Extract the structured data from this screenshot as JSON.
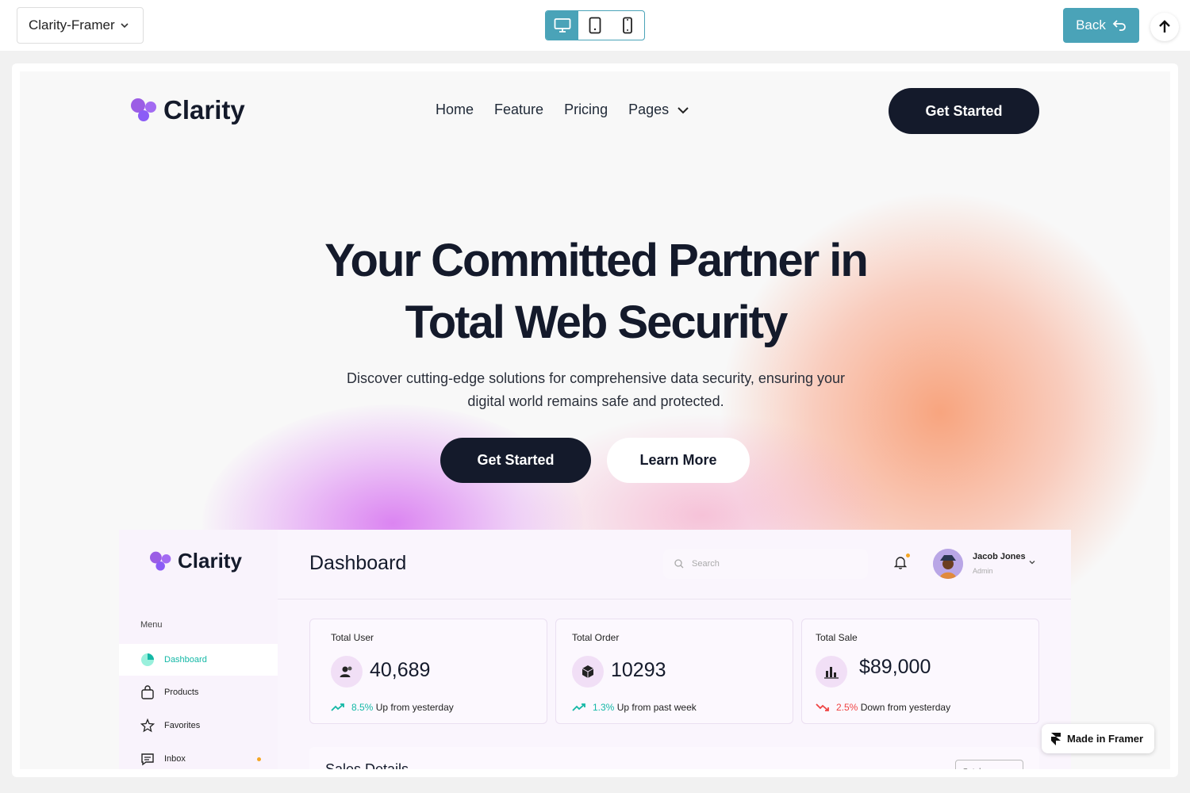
{
  "toolbar": {
    "template_name": "Clarity-Framer",
    "devices": [
      "desktop",
      "tablet",
      "mobile"
    ],
    "active_device": "desktop",
    "back_label": "Back",
    "accent_color": "#4aa3b8"
  },
  "site": {
    "logo_text": "Clarity",
    "nav": {
      "links": [
        "Home",
        "Feature",
        "Pricing",
        "Pages"
      ],
      "cta": "Get Started"
    },
    "hero": {
      "title_line1": "Your Committed Partner in",
      "title_line2": "Total Web Security",
      "subtitle_line1": "Discover cutting-edge solutions for comprehensive data security, ensuring your",
      "subtitle_line2": "digital world remains safe and protected.",
      "primary_cta": "Get Started",
      "secondary_cta": "Learn More"
    },
    "dashboard": {
      "logo_text": "Clarity",
      "title": "Dashboard",
      "search_placeholder": "Search",
      "user": {
        "name": "Jacob Jones",
        "role": "Admin"
      },
      "menu_label": "Menu",
      "menu_items": [
        {
          "label": "Dashboard",
          "icon": "pie-chart-icon",
          "active": true
        },
        {
          "label": "Products",
          "icon": "bag-icon"
        },
        {
          "label": "Favorites",
          "icon": "star-icon"
        },
        {
          "label": "Inbox",
          "icon": "chat-icon",
          "badge": true
        }
      ],
      "stats": [
        {
          "label": "Total User",
          "value": "40,689",
          "icon": "users-icon",
          "pct": "8.5%",
          "trend_text": "Up from yesterday",
          "direction": "up"
        },
        {
          "label": "Total Order",
          "value": "10293",
          "icon": "box-icon",
          "pct": "1.3%",
          "trend_text": "Up from past week",
          "direction": "up"
        },
        {
          "label": "Total Sale",
          "value": "$89,000",
          "icon": "bar-chart-icon",
          "pct": "2.5%",
          "trend_text": "Down from yesterday",
          "direction": "down"
        }
      ],
      "sales_title": "Sales Details",
      "sales_select": "October"
    },
    "brand_colors": {
      "dark": "#141a2b",
      "teal": "#14b8a6",
      "red": "#ef4444",
      "purple": "#8b5cf6"
    }
  },
  "framer_badge": "Made in Framer"
}
